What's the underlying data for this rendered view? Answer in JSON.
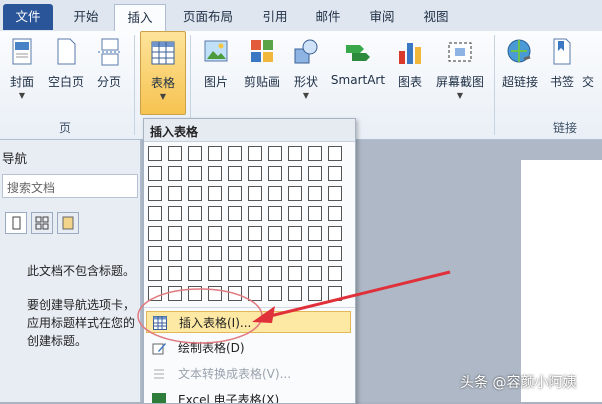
{
  "tabs": [
    "文件",
    "开始",
    "插入",
    "页面布局",
    "引用",
    "邮件",
    "审阅",
    "视图"
  ],
  "ribbon": {
    "pages_group": {
      "label": "页",
      "buttons": [
        "封面",
        "空白页",
        "分页"
      ]
    },
    "table_button": "表格",
    "illustration_buttons": [
      "图片",
      "剪贴画",
      "形状",
      "SmartArt",
      "图表",
      "屏幕截图"
    ],
    "links_group": {
      "label": "链接",
      "buttons": [
        "超链接",
        "书签",
        "交"
      ]
    }
  },
  "nav_pane": {
    "title": "导航",
    "search_placeholder": "搜索文档",
    "msg_no_headings": "此文档不包含标题。",
    "msg_line1": "要创建导航选项卡，",
    "msg_line2": "应用标题样式在您的",
    "msg_line3": "创建标题。"
  },
  "table_menu": {
    "header": "插入表格",
    "items": [
      {
        "label": "插入表格(I)...",
        "state": "highlighted"
      },
      {
        "label": "绘制表格(D)",
        "state": "normal"
      },
      {
        "label": "文本转换成表格(V)...",
        "state": "disabled"
      },
      {
        "label": "Excel 电子表格(X)",
        "state": "normal"
      }
    ]
  },
  "watermark": "头条 @容颜小阿姨",
  "colors": {
    "file_tab": "#2a5699",
    "highlight": "#fde9a3",
    "arrow": "#e0303a"
  }
}
